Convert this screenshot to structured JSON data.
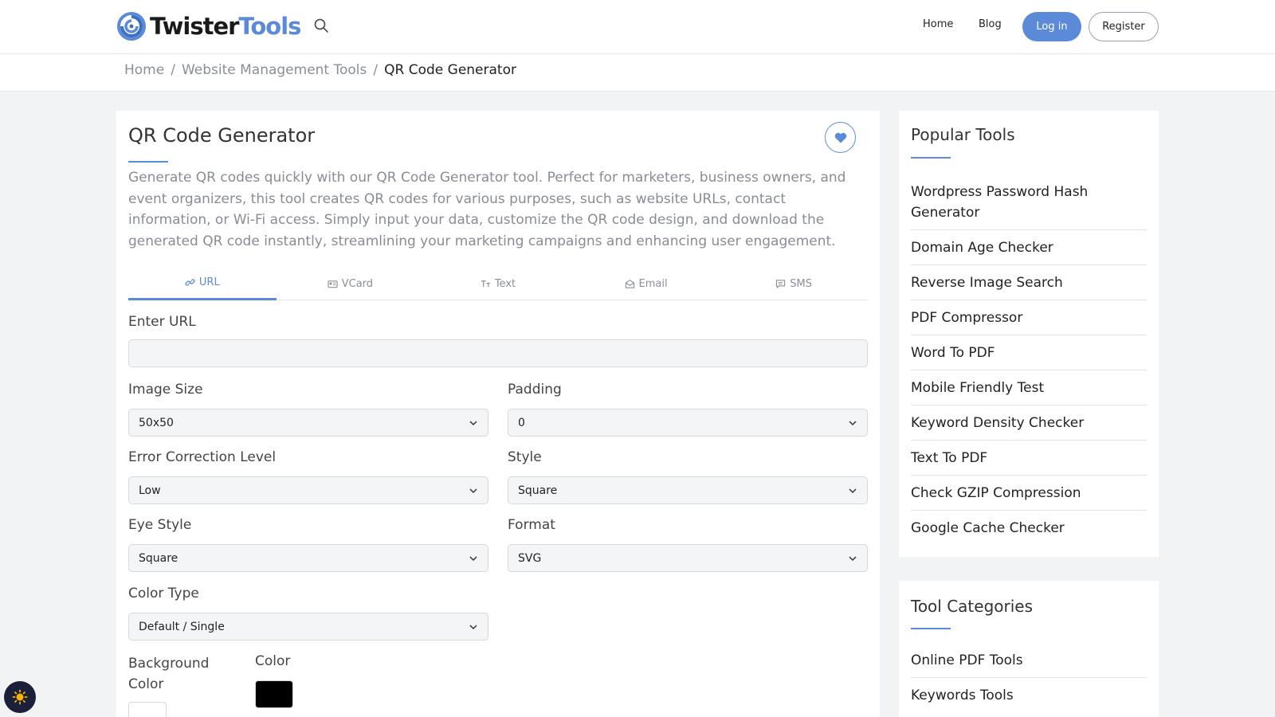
{
  "header": {
    "logo_text_a": "Twister",
    "logo_text_b": "Tools",
    "nav": [
      {
        "label": "Home"
      },
      {
        "label": "Blog"
      }
    ],
    "login_label": "Log in",
    "register_label": "Register",
    "brand_color": "#5b8bd8"
  },
  "breadcrumb": {
    "items": [
      "Home",
      "Website Management Tools"
    ],
    "separator": "/",
    "current": "QR Code Generator"
  },
  "tool": {
    "title": "QR Code Generator",
    "description": "Generate QR codes quickly with our QR Code Generator tool. Perfect for marketers, business owners, and event organizers, this tool creates QR codes for various purposes, such as website URLs, contact information, or Wi-Fi access. Simply input your data, customize the QR code design, and download the generated QR code instantly, streamlining your marketing campaigns and enhancing user engagement.",
    "tabs": [
      {
        "label": "URL",
        "icon": "link-icon",
        "active": true
      },
      {
        "label": "VCard",
        "icon": "id-card-icon",
        "active": false
      },
      {
        "label": "Text",
        "icon": "text-icon",
        "active": false
      },
      {
        "label": "Email",
        "icon": "envelope-icon",
        "active": false
      },
      {
        "label": "SMS",
        "icon": "message-icon",
        "active": false
      }
    ],
    "url_label": "Enter URL",
    "url_value": "",
    "fields": {
      "image_size": {
        "label": "Image Size",
        "value": "50x50"
      },
      "padding": {
        "label": "Padding",
        "value": "0"
      },
      "error_correction": {
        "label": "Error Correction Level",
        "value": "Low"
      },
      "style": {
        "label": "Style",
        "value": "Square"
      },
      "eye_style": {
        "label": "Eye Style",
        "value": "Square"
      },
      "format": {
        "label": "Format",
        "value": "SVG"
      },
      "color_type": {
        "label": "Color Type",
        "value": "Default / Single"
      }
    },
    "background_color_label_1": "Background",
    "background_color_label_2": "Color",
    "background_color": "#ffffff",
    "color_label": "Color",
    "color": "#000000"
  },
  "popular_tools": {
    "title": "Popular Tools",
    "items": [
      "Wordpress Password Hash Generator",
      "Domain Age Checker",
      "Reverse Image Search",
      "PDF Compressor",
      "Word To PDF",
      "Mobile Friendly Test",
      "Keyword Density Checker",
      "Text To PDF",
      "Check GZIP Compression",
      "Google Cache Checker"
    ]
  },
  "tool_categories": {
    "title": "Tool Categories",
    "items": [
      "Online PDF Tools",
      "Keywords Tools"
    ]
  },
  "theme_toggle_icon": "sun-icon"
}
